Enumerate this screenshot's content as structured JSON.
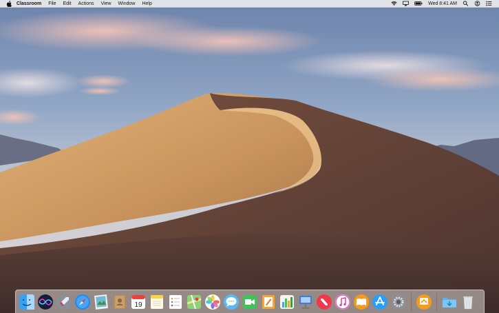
{
  "menubar": {
    "app_name": "Classroom",
    "menus": [
      "File",
      "Edit",
      "Actions",
      "View",
      "Window",
      "Help"
    ],
    "clock": "Wed 8:41 AM",
    "status_icons": [
      "wifi-icon",
      "airplay-icon",
      "battery-icon",
      "search-icon",
      "user-icon",
      "notification-center-icon"
    ]
  },
  "calendar": {
    "day": "19"
  },
  "dock": {
    "apps": [
      "finder",
      "siri",
      "launchpad",
      "safari",
      "photo-browser",
      "contacts",
      "calendar",
      "notes",
      "reminders",
      "maps",
      "photos",
      "messages",
      "facetime",
      "pages",
      "numbers",
      "keynote",
      "news",
      "itunes",
      "ibooks",
      "app-store",
      "system-preferences"
    ],
    "extra_apps": [
      "classroom"
    ],
    "stacks": [
      "downloads",
      "trash"
    ]
  },
  "colors": {
    "sky_top": "#6f87ad",
    "sky_pink": "#e8b7b0",
    "dune_light": "#d6a66a",
    "dune_shadow": "#6e4a39"
  }
}
